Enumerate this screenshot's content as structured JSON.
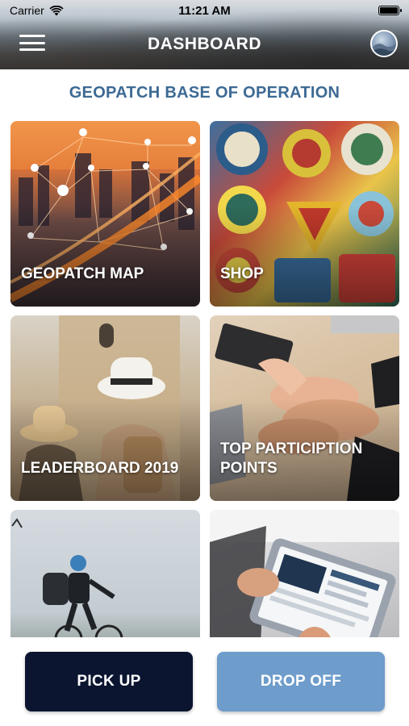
{
  "status_bar": {
    "carrier": "Carrier",
    "time": "11:21 AM"
  },
  "header": {
    "title": "DASHBOARD",
    "menu_icon": "hamburger-menu-icon",
    "avatar_icon": "profile-avatar"
  },
  "section": {
    "title": "GEOPATCH BASE OF OPERATION"
  },
  "tiles": [
    {
      "label": "GEOPATCH MAP"
    },
    {
      "label": "SHOP"
    },
    {
      "label": "LEADERBOARD 2019"
    },
    {
      "label": "TOP PARTICIPTION POINTS"
    },
    {
      "label": ""
    },
    {
      "label": ""
    }
  ],
  "actions": {
    "pick_up": "PICK UP",
    "drop_off": "DROP OFF"
  },
  "colors": {
    "title_blue": "#3d6a94",
    "pick_up_bg": "#0b1530",
    "drop_off_bg": "#6e9ccb"
  }
}
